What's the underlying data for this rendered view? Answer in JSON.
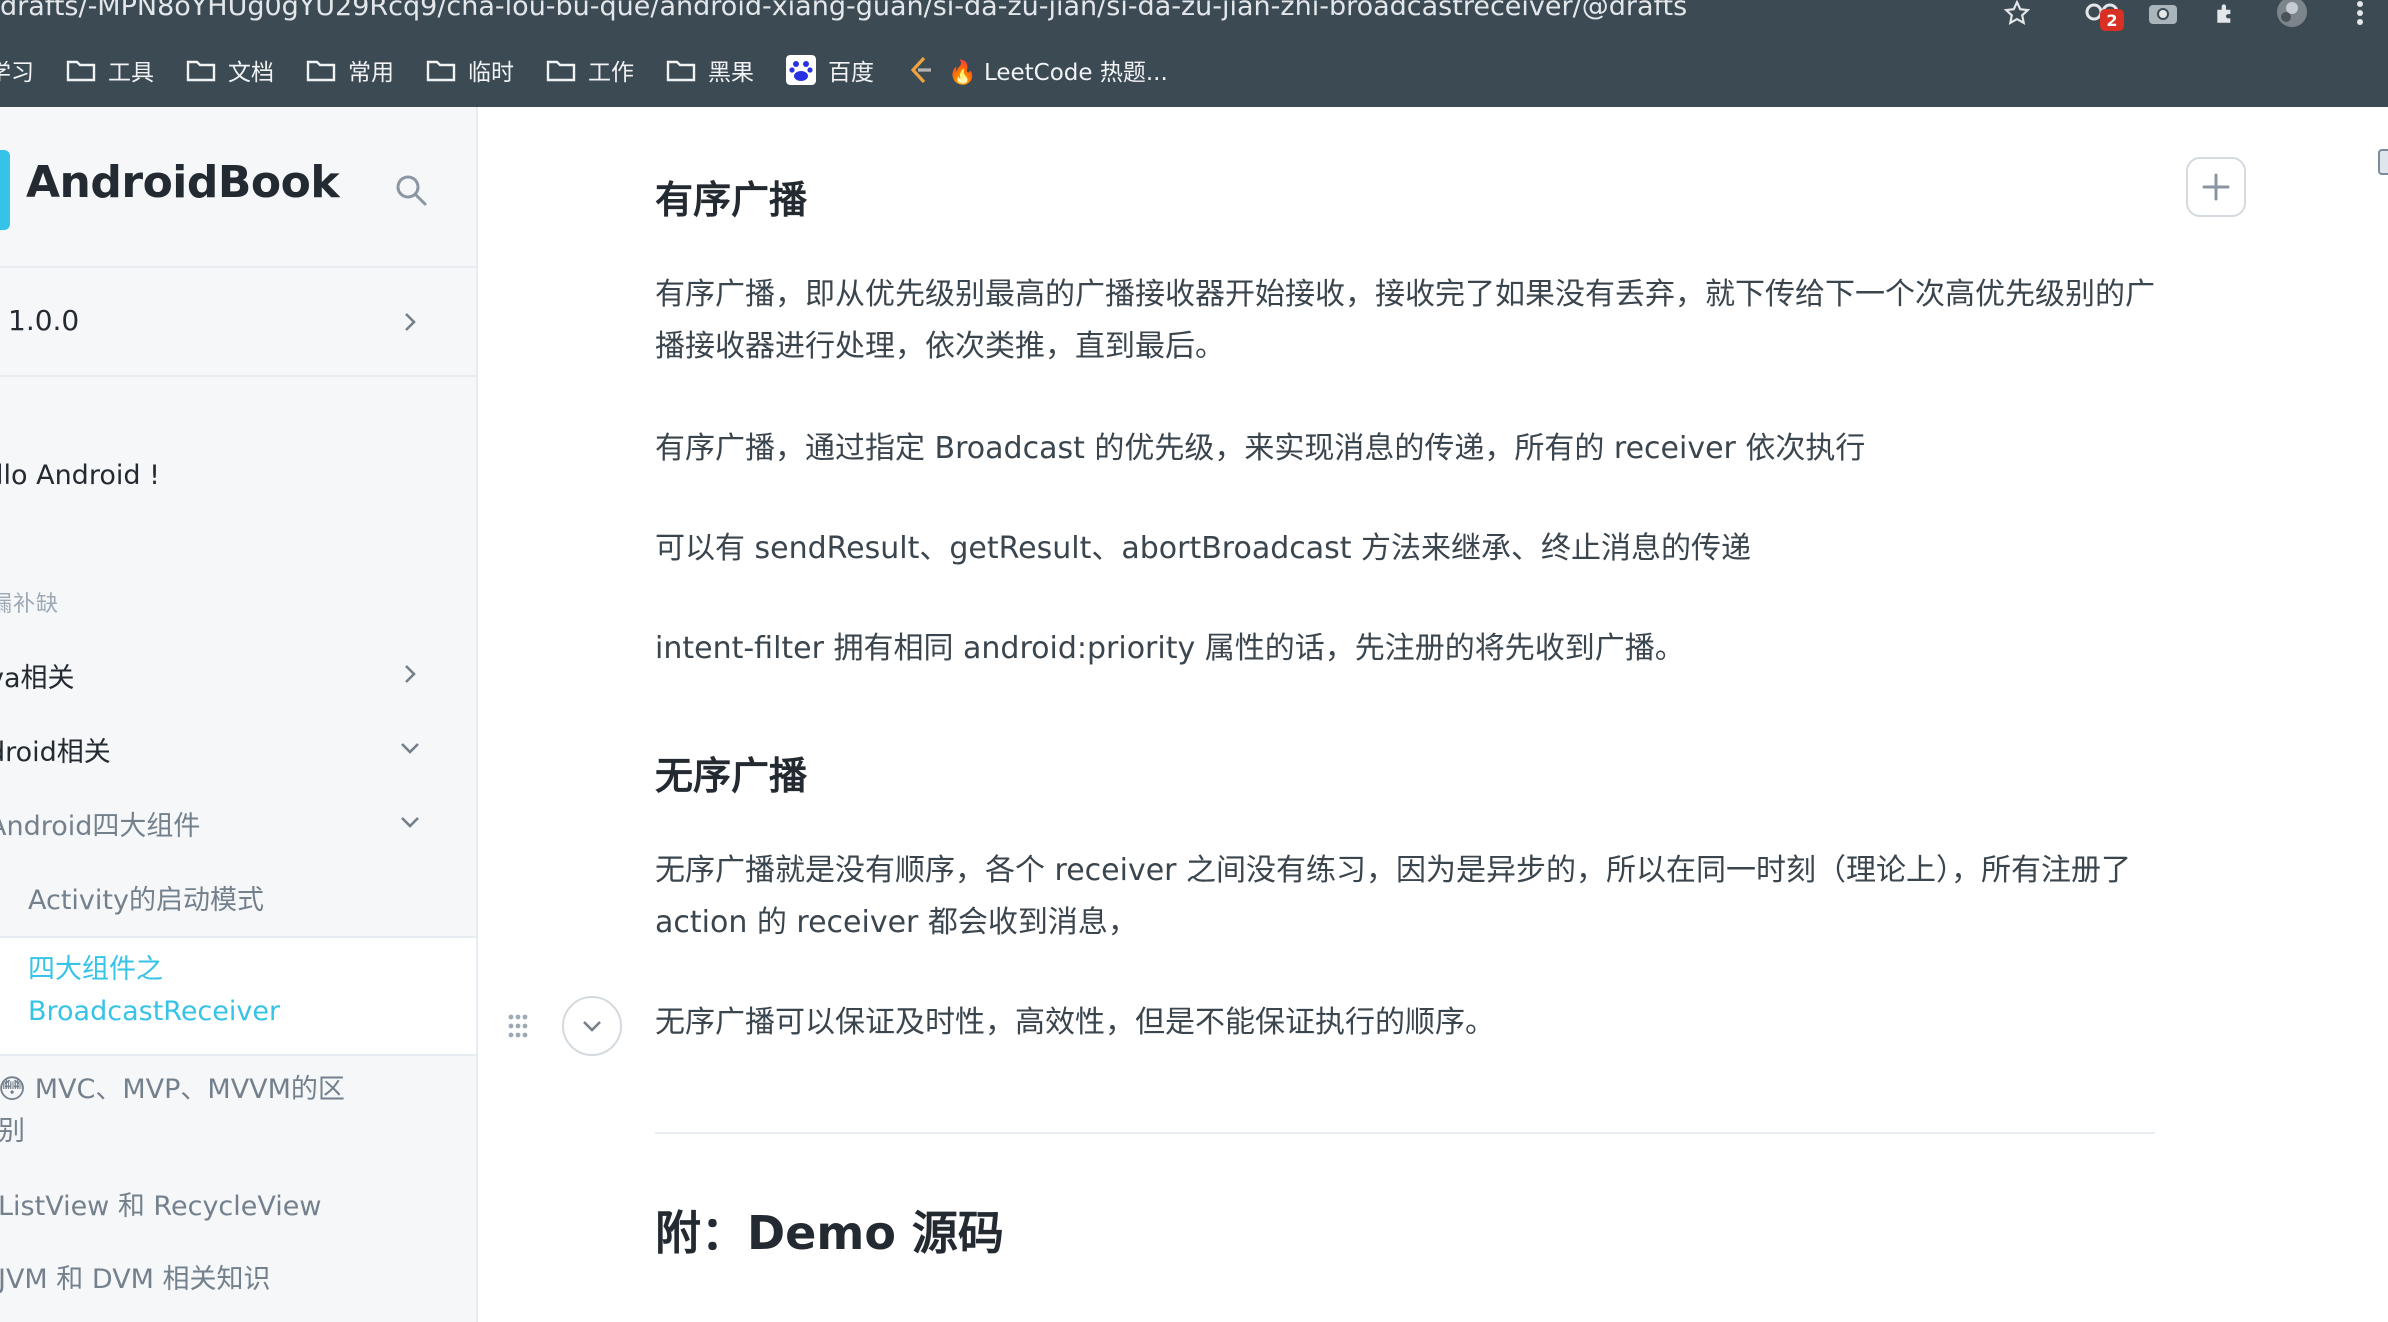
{
  "browser": {
    "url": "drafts/-MPN8oYHUg0gYU29Rcq9/cha-lou-bu-que/android-xiang-guan/si-da-zu-jian/si-da-zu-jian-zhi-broadcastreceiver/@drafts",
    "extension_badge": "2",
    "bookmarks": [
      {
        "label": "学习",
        "icon": "folder-icon"
      },
      {
        "label": "工具",
        "icon": "folder-icon"
      },
      {
        "label": "文档",
        "icon": "folder-icon"
      },
      {
        "label": "常用",
        "icon": "folder-icon"
      },
      {
        "label": "临时",
        "icon": "folder-icon"
      },
      {
        "label": "工作",
        "icon": "folder-icon"
      },
      {
        "label": "黑果",
        "icon": "folder-icon"
      },
      {
        "label": "百度",
        "icon": "baidu-icon"
      },
      {
        "label": "🔥 LeetCode 热题...",
        "icon": "leetcode-icon"
      }
    ]
  },
  "sidebar": {
    "brand": "AndroidBook",
    "version": "1.0.0",
    "intro": "llo Android !",
    "section": "漏补缺",
    "items": {
      "java": "va相关",
      "android": "droid相关",
      "four_components": "Android四大组件",
      "activity_launch": "Activity的启动模式",
      "active_line1": "四大组件之",
      "active_line2": "BroadcastReceiver",
      "mvc_line1": "😳 MVC、MVP、MVVM的区",
      "mvc_line2": "别",
      "listview": "ListView 和 RecycleView",
      "jvm": "JVM 和 DVM 相关知识"
    }
  },
  "content": {
    "ordered_title": "有序广播",
    "ordered_p1": "有序广播，即从优先级别最高的广播接收器开始接收，接收完了如果没有丢弃，就下传给下一个次高优先级别的广播接收器进行处理，依次类推，直到最后。",
    "ordered_p2": "有序广播，通过指定 Broadcast 的优先级，来实现消息的传递，所有的 receiver 依次执行",
    "ordered_p3": "可以有 sendResult、getResult、abortBroadcast 方法来继承、终止消息的传递",
    "ordered_p4": "intent-filter 拥有相同 android:priority 属性的话，先注册的将先收到广播。",
    "unordered_title": "无序广播",
    "unordered_p1": "无序广播就是没有顺序，各个 receiver 之间没有练习，因为是异步的，所以在同一时刻（理论上），所有注册了 action 的 receiver 都会收到消息，",
    "unordered_p2": "无序广播可以保证及时性，高效性，但是不能保证执行的顺序。",
    "demo_title": "附：Demo 源码"
  },
  "colors": {
    "chrome_bg": "#3c4a54",
    "accent": "#35c3e8",
    "sidebar_bg": "#f5f7f9",
    "text": "#242a31"
  }
}
